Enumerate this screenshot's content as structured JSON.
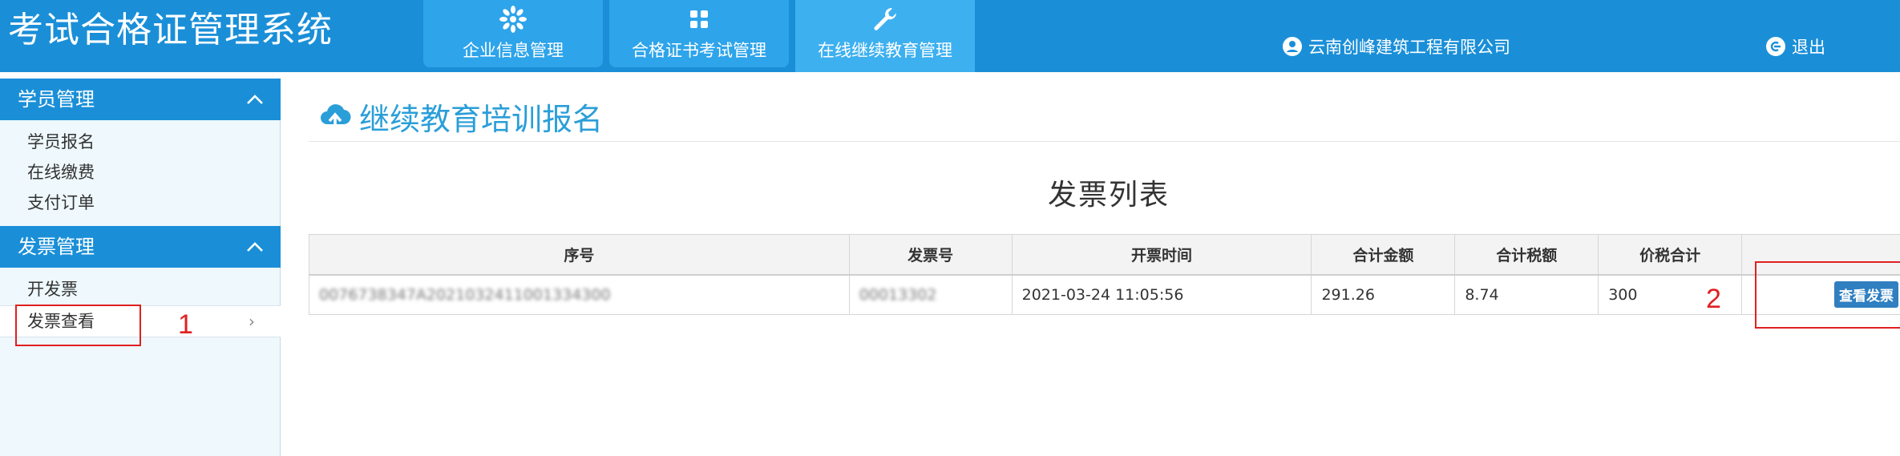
{
  "header": {
    "app_title": "考试合格证管理系统",
    "tabs": [
      {
        "label": "企业信息管理",
        "icon": "sun-flower-icon"
      },
      {
        "label": "合格证书考试管理",
        "icon": "grid-icon"
      },
      {
        "label": "在线继续教育管理",
        "icon": "wrench-icon",
        "active": true
      }
    ],
    "company": "云南创峰建筑工程有限公司",
    "logout": "退出"
  },
  "sidebar": {
    "groups": [
      {
        "title": "学员管理",
        "items": [
          "学员报名",
          "在线缴费",
          "支付订单"
        ]
      },
      {
        "title": "发票管理",
        "items": [
          "开发票",
          "发票查看"
        ]
      }
    ],
    "selected": "发票查看"
  },
  "main": {
    "page_title": "继续教育培训报名",
    "list_title": "发票列表",
    "columns": [
      "序号",
      "发票号",
      "开票时间",
      "合计金额",
      "合计税额",
      "价税合计",
      ""
    ],
    "rows": [
      {
        "serial": "0076738347A202103241100133430​0",
        "invoice_no": "00013302",
        "time": "2021-03-24 11:05:56",
        "amount": "291.26",
        "tax": "8.74",
        "total": "300",
        "action": "查看发票"
      }
    ]
  },
  "annotations": {
    "one": "1",
    "two": "2"
  },
  "colors": {
    "header_bg": "#1a8fd8",
    "accent": "#2a9ed8",
    "annotation": "#e02020"
  }
}
